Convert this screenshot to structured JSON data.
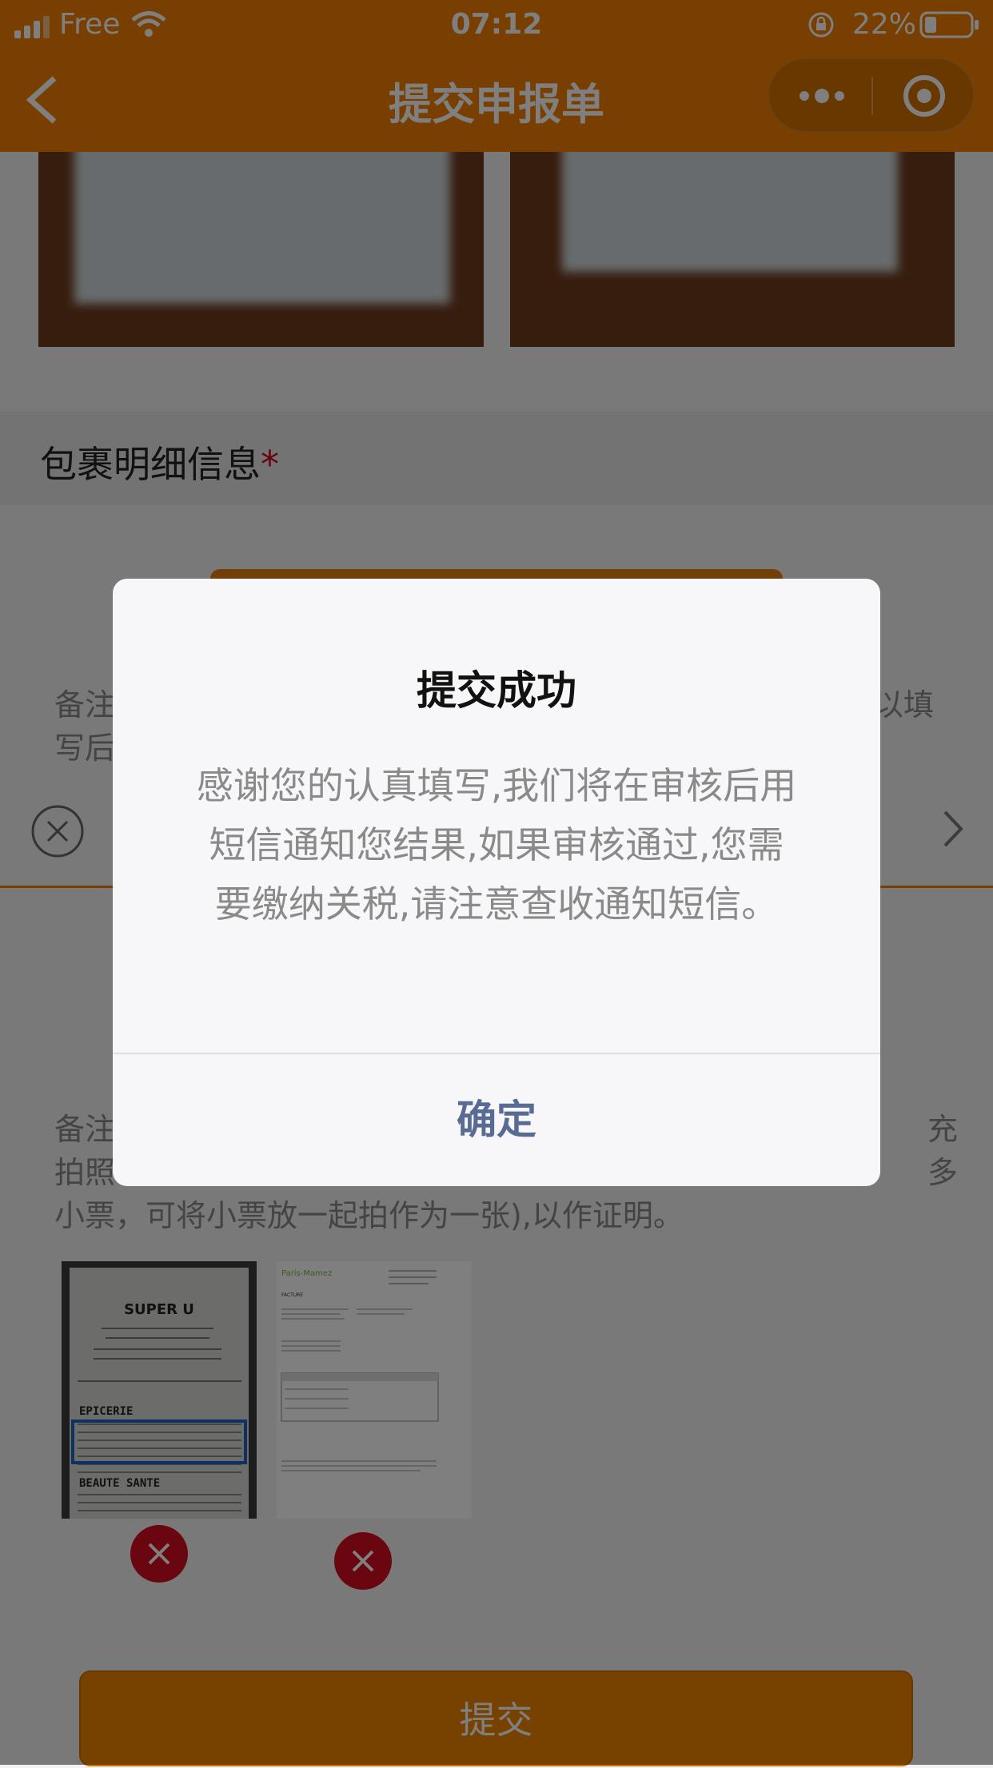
{
  "status_bar": {
    "carrier": "Free",
    "time": "07:12",
    "battery": "22%"
  },
  "nav": {
    "title": "提交申报单",
    "back_icon": "chevron-left-icon",
    "more_icon": "more-dots-icon",
    "close_icon": "target-circle-icon"
  },
  "package_section": {
    "title": "包裹明细信息",
    "required_mark": "*"
  },
  "note1": {
    "left": "备注",
    "left2": "写后",
    "right": "以填"
  },
  "note2": {
    "line1_left": "备注",
    "line1_right": "充",
    "line2_left": "拍照",
    "line2_right": "多",
    "line3": "小票，可将小票放一起拍作为一张),以作证明。"
  },
  "receipt_thumb": {
    "brand": "SUPER U",
    "heading1": "EPICERIE",
    "heading2": "BEAUTE SANTE"
  },
  "invoice_thumb": {
    "brand": "Paris-Mamez",
    "heading": "FACTURE"
  },
  "submit": {
    "label": "提交"
  },
  "dialog": {
    "title": "提交成功",
    "message": "感谢您的认真填写,我们将在审核后用短信通知您结果,如果审核通过,您需要缴纳关税,请注意查收通知短信。",
    "ok_label": "确定"
  },
  "colors": {
    "accent": "#f07f00",
    "delete": "#d40c1e",
    "link": "#576b95"
  }
}
